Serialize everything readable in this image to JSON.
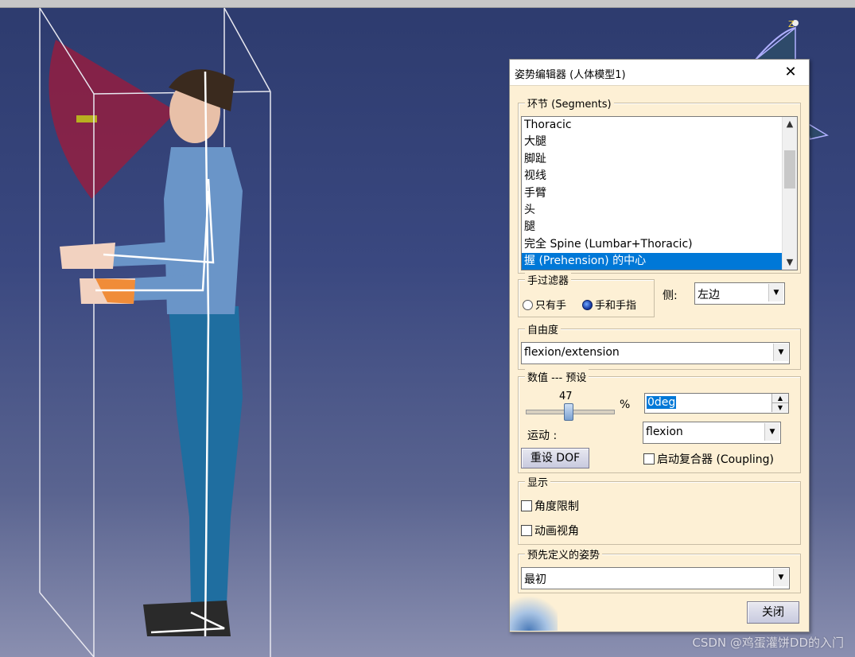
{
  "watermark": "CSDN @鸡蛋灌饼DD的入门",
  "compass": {
    "axis_label": "Z"
  },
  "dialog": {
    "title": "姿势编辑器 (人体模型1)",
    "close_glyph": "✕",
    "segments": {
      "legend": "环节 (Segments)",
      "items": [
        "Thoracic",
        "大腿",
        "脚趾",
        "视线",
        "手臂",
        "头",
        "腿",
        "完全 Spine (Lumbar+Thoracic)",
        "握 (Prehension) 的中心"
      ],
      "selected_index": 8
    },
    "hand_filter": {
      "legend": "手过滤器",
      "option_hand_only": "只有手",
      "option_hand_fingers": "手和手指",
      "selected": "手和手指"
    },
    "side": {
      "label": "侧:",
      "value": "左边"
    },
    "dof": {
      "legend": "自由度",
      "value": "flexion/extension"
    },
    "values": {
      "legend": "数值 --- 预设",
      "slider_value": "47",
      "slider_fraction": 0.47,
      "unit": "%",
      "angle_value": "0deg",
      "motion_label": "运动 :",
      "motion_value": "flexion",
      "reset_button": "重设 DOF",
      "coupling_label": "启动复合器 (Coupling)"
    },
    "display": {
      "legend": "显示",
      "angle_limits": "角度限制",
      "animate_view": "动画视角"
    },
    "predefined": {
      "legend": "预先定义的姿势",
      "value": "最初"
    },
    "close_button": "关闭"
  }
}
